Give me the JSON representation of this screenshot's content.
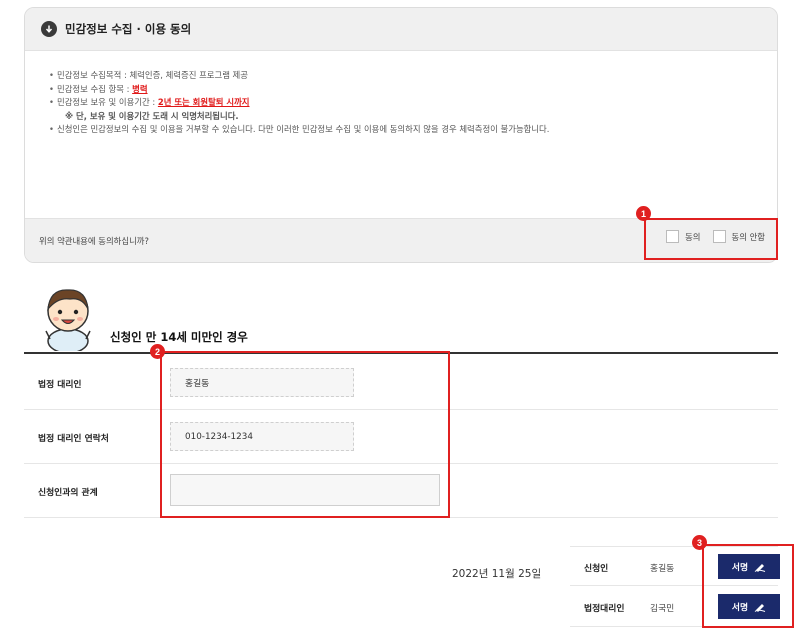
{
  "consent": {
    "title": "민감정보 수집 · 이용 동의",
    "purpose": "민감정보 수집목적 : 체력인증, 체력증진 프로그램 제공",
    "item_prefix": "민감정보 수집 항목 : ",
    "item_value": "병력",
    "period_prefix": "민감정보 보유 및 이용기간 : ",
    "period_value": "2년 또는 회원탈퇴 시까지",
    "note": "※ 단, 보유 및 이용기간 도래 시 익명처리됩니다.",
    "refusal": "신청인은 민감정보의 수집 및 이용을 거부할 수 있습니다. 다만 이러한 민감정보 수집 및 이용에 동의하지 않을 경우 체력측정이 불가능합니다.",
    "question": "위의 약관내용에 동의하십니까?",
    "agree_label": "동의",
    "disagree_label": "동의 안함"
  },
  "guardian_section": {
    "title": "신청인 만 14세 미만인 경우",
    "rows": [
      {
        "label": "법정 대리인",
        "value": "홍길동"
      },
      {
        "label": "법정 대리인 연락처",
        "value": "010-1234-1234"
      },
      {
        "label": "신청인과의 관계",
        "value": ""
      }
    ]
  },
  "signature": {
    "date": "2022년 11월 25일",
    "rows": [
      {
        "role": "신청인",
        "name": "홍길동",
        "button": "서명"
      },
      {
        "role": "법정대리인",
        "name": "김국민",
        "button": "서명"
      }
    ]
  },
  "markers": [
    "1",
    "2",
    "3"
  ],
  "colors": {
    "highlight": "#e02020",
    "sign_button": "#1b2a6b",
    "warning_text": "#e01818"
  }
}
